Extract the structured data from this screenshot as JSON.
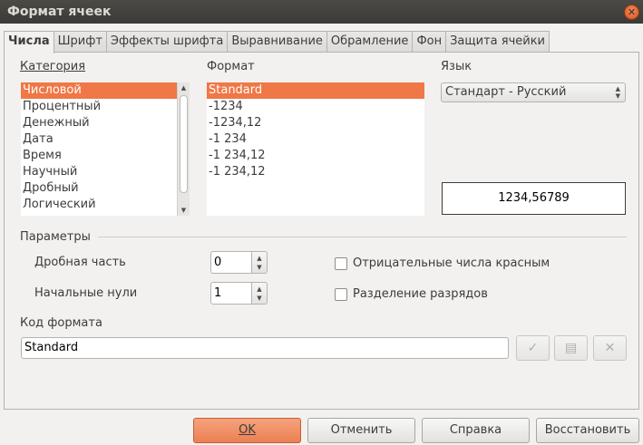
{
  "window": {
    "title": "Формат ячеек"
  },
  "tabs": [
    {
      "label": "Числа"
    },
    {
      "label": "Шрифт"
    },
    {
      "label": "Эффекты шрифта"
    },
    {
      "label": "Выравнивание"
    },
    {
      "label": "Обрамление"
    },
    {
      "label": "Фон"
    },
    {
      "label": "Защита ячейки"
    }
  ],
  "category": {
    "label": "Категория",
    "items": [
      "Числовой",
      "Процентный",
      "Денежный",
      "Дата",
      "Время",
      "Научный",
      "Дробный",
      "Логический"
    ],
    "selected_index": 0
  },
  "format": {
    "label": "Формат",
    "items": [
      "Standard",
      "-1234",
      "-1234,12",
      "-1 234",
      "-1 234,12",
      "-1 234,12"
    ],
    "selected_index": 0
  },
  "language": {
    "label": "Язык",
    "value": "Стандарт - Русский"
  },
  "preview": {
    "value": "1234,56789"
  },
  "options": {
    "heading": "Параметры",
    "decimal_places_label": "Дробная часть",
    "decimal_places_value": "0",
    "leading_zeros_label": "Начальные нули",
    "leading_zeros_value": "1",
    "negative_red_label": "Отрицательные числа красным",
    "negative_red_checked": false,
    "thousands_sep_label": "Разделение разрядов",
    "thousands_sep_checked": false
  },
  "format_code": {
    "label": "Код формата",
    "value": "Standard"
  },
  "buttons": {
    "ok": "OK",
    "cancel": "Отменить",
    "help": "Справка",
    "reset": "Восстановить"
  },
  "icons": {
    "close": "close-icon",
    "apply": "checkmark-icon",
    "comment": "comment-icon",
    "delete": "delete-icon",
    "spin_up": "chevron-up-icon",
    "spin_down": "chevron-down-icon"
  },
  "colors": {
    "accent": "#f07746",
    "titlebar": "#3c3b37"
  }
}
